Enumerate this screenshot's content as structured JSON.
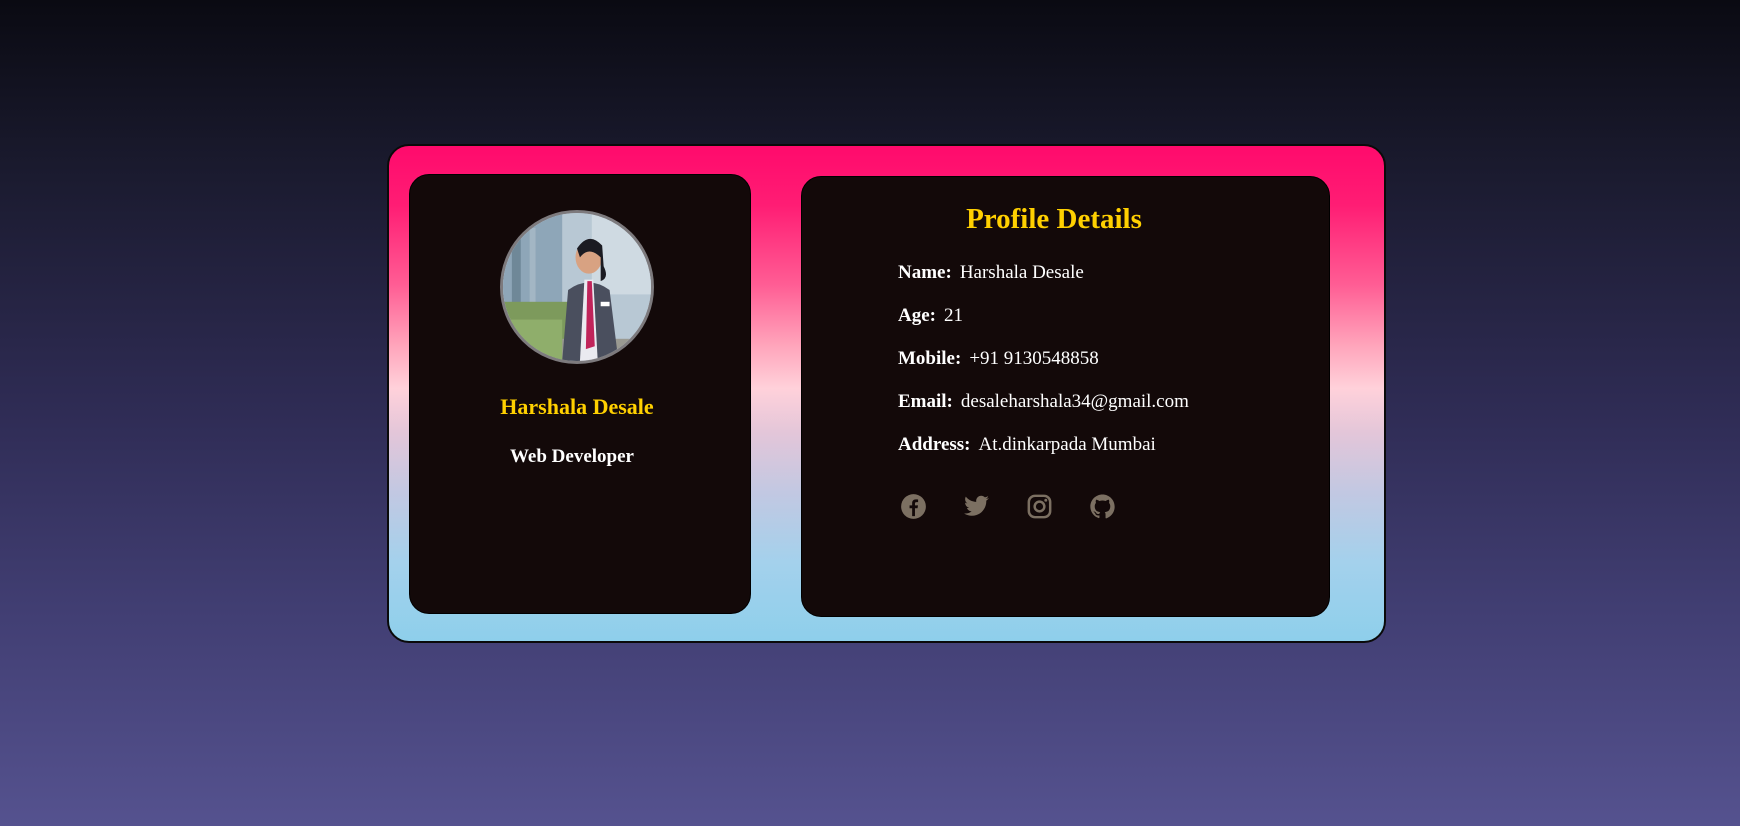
{
  "profile_card": {
    "name": "Harshala Desale",
    "role": "Web Developer",
    "avatar_alt": "profile photo"
  },
  "details": {
    "title": "Profile Details",
    "rows": [
      {
        "label": "Name:",
        "value": "Harshala Desale"
      },
      {
        "label": "Age:",
        "value": "21"
      },
      {
        "label": "Mobile:",
        "value": "+91 9130548858"
      },
      {
        "label": "Email:",
        "value": "desaleharshala34@gmail.com"
      },
      {
        "label": "Address:",
        "value": "At.dinkarpada Mumbai"
      }
    ]
  },
  "social": [
    {
      "name": "facebook-icon"
    },
    {
      "name": "twitter-icon"
    },
    {
      "name": "instagram-icon"
    },
    {
      "name": "github-icon"
    }
  ],
  "colors": {
    "accent": "#ffd000",
    "panel": "#130909",
    "icon": "#7c7062",
    "card_gradient_top": "#ff0a6c",
    "card_gradient_bottom": "#8ecfeb"
  }
}
